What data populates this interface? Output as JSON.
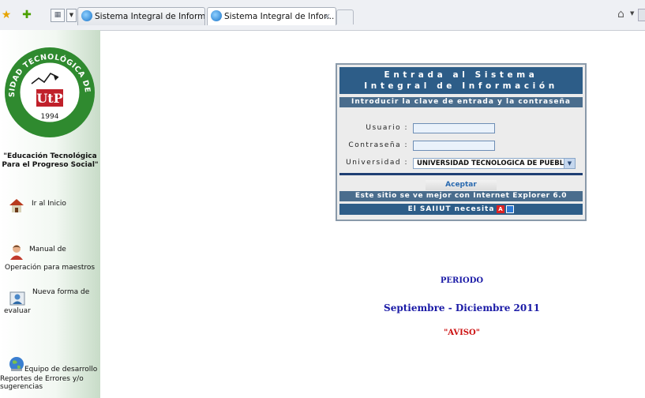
{
  "browser": {
    "tabs": [
      {
        "label": "Sistema Integral de Informac..."
      },
      {
        "label": "Sistema Integral de Infor..."
      }
    ],
    "close_glyph": "×"
  },
  "sidebar": {
    "logo": {
      "arc_text": "UNIVERSIDAD TECNOLÓGICA DE PUEBLA",
      "year": "1994",
      "brand": "UtP"
    },
    "motto_line1": "\"Educación Tecnológica",
    "motto_line2": "Para el Progreso Social\"",
    "items": [
      {
        "label": "Ir al Inicio",
        "icon": "house-icon"
      },
      {
        "label_line1": "Manual de",
        "label_line2": "Operación para maestros",
        "icon": "teacher-icon"
      },
      {
        "label_line1": "Nueva forma de",
        "label_line2": "evaluar",
        "icon": "evaluation-icon"
      },
      {
        "label_line1": "Equipo de desarrollo",
        "label_line2": "Reportes de Errores y/o",
        "label_line3": "sugerencias",
        "icon": "globe-icon"
      }
    ]
  },
  "login": {
    "title_line1": "Entrada al Sistema",
    "title_line2": "Integral de Información",
    "subtitle": "Introducir la clave de entrada y la contraseña",
    "usuario_label": "Usuario :",
    "usuario_value": "",
    "password_label": "Contraseña :",
    "password_value": "",
    "universidad_label": "Universidad :",
    "universidad_selected": "UNIVERSIDAD TECNOLOGICA DE PUEBLA",
    "submit_label": "Aceptar",
    "browser_note": "Este sitio se ve mejor con Internet Explorer 6.0",
    "requires_text": "El SAIIUT necesita"
  },
  "notice": {
    "periodo": "PERIODO",
    "dates": "Septiembre - Diciembre 2011",
    "aviso": "\"AVISO\""
  },
  "colors": {
    "panel_header": "#2d5d88",
    "panel_divider": "#1f3f73",
    "notice_blue": "#1a1aa6",
    "aviso_red": "#cc1111",
    "logo_green": "#2f8a2f",
    "logo_red": "#c0202a"
  }
}
